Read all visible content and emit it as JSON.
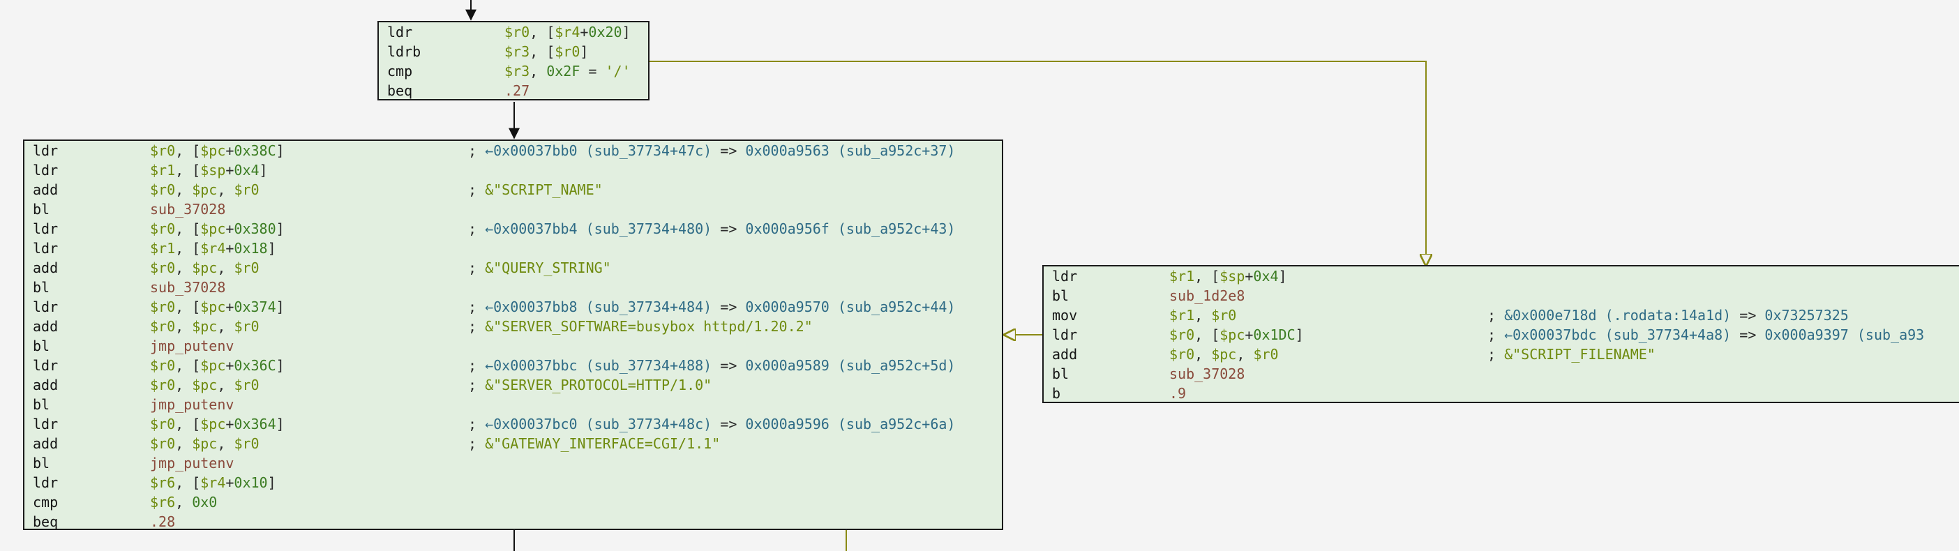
{
  "blocks": {
    "top": [
      [
        "ldr",
        "$r0",
        ", [",
        "$r4",
        "+",
        "0x20",
        "]"
      ],
      [
        "ldrb",
        "$r3",
        ", [",
        "$r0",
        "]"
      ],
      [
        "cmp",
        "$r3",
        ", ",
        "0x2F",
        " = ",
        "'/'"
      ],
      [
        "beq",
        ".27"
      ]
    ],
    "left": [
      {
        "m": "ldr",
        "o": [
          "$r0",
          ", [",
          "$pc",
          "+",
          "0x38C",
          "]"
        ],
        "c": [
          "; ",
          "←0x00037bb0 (sub_37734+47c) => 0x000a9563 (sub_a952c+37)"
        ]
      },
      {
        "m": "ldr",
        "o": [
          "$r1",
          ", [",
          "$sp",
          "+",
          "0x4",
          "]"
        ]
      },
      {
        "m": "add",
        "o": [
          "$r0",
          ", ",
          "$pc",
          ", ",
          "$r0"
        ],
        "c": [
          "; ",
          "&\"SCRIPT_NAME\""
        ]
      },
      {
        "m": "bl",
        "o": [
          "sub_37028"
        ]
      },
      {
        "m": "ldr",
        "o": [
          "$r0",
          ", [",
          "$pc",
          "+",
          "0x380",
          "]"
        ],
        "c": [
          "; ",
          "←0x00037bb4 (sub_37734+480) => 0x000a956f (sub_a952c+43)"
        ]
      },
      {
        "m": "ldr",
        "o": [
          "$r1",
          ", [",
          "$r4",
          "+",
          "0x18",
          "]"
        ]
      },
      {
        "m": "add",
        "o": [
          "$r0",
          ", ",
          "$pc",
          ", ",
          "$r0"
        ],
        "c": [
          "; ",
          "&\"QUERY_STRING\""
        ]
      },
      {
        "m": "bl",
        "o": [
          "sub_37028"
        ]
      },
      {
        "m": "ldr",
        "o": [
          "$r0",
          ", [",
          "$pc",
          "+",
          "0x374",
          "]"
        ],
        "c": [
          "; ",
          "←0x00037bb8 (sub_37734+484) => 0x000a9570 (sub_a952c+44)"
        ]
      },
      {
        "m": "add",
        "o": [
          "$r0",
          ", ",
          "$pc",
          ", ",
          "$r0"
        ],
        "c": [
          "; ",
          "&\"SERVER_SOFTWARE=busybox httpd/1.20.2\""
        ]
      },
      {
        "m": "bl",
        "o": [
          "jmp_putenv"
        ]
      },
      {
        "m": "ldr",
        "o": [
          "$r0",
          ", [",
          "$pc",
          "+",
          "0x36C",
          "]"
        ],
        "c": [
          "; ",
          "←0x00037bbc (sub_37734+488) => 0x000a9589 (sub_a952c+5d)"
        ]
      },
      {
        "m": "add",
        "o": [
          "$r0",
          ", ",
          "$pc",
          ", ",
          "$r0"
        ],
        "c": [
          "; ",
          "&\"SERVER_PROTOCOL=HTTP/1.0\""
        ]
      },
      {
        "m": "bl",
        "o": [
          "jmp_putenv"
        ]
      },
      {
        "m": "ldr",
        "o": [
          "$r0",
          ", [",
          "$pc",
          "+",
          "0x364",
          "]"
        ],
        "c": [
          "; ",
          "←0x00037bc0 (sub_37734+48c) => 0x000a9596 (sub_a952c+6a)"
        ]
      },
      {
        "m": "add",
        "o": [
          "$r0",
          ", ",
          "$pc",
          ", ",
          "$r0"
        ],
        "c": [
          "; ",
          "&\"GATEWAY_INTERFACE=CGI/1.1\""
        ]
      },
      {
        "m": "bl",
        "o": [
          "jmp_putenv"
        ]
      },
      {
        "m": "ldr",
        "o": [
          "$r6",
          ", [",
          "$r4",
          "+",
          "0x10",
          "]"
        ]
      },
      {
        "m": "cmp",
        "o": [
          "$r6",
          ", ",
          "0x0"
        ]
      },
      {
        "m": "beq",
        "o": [
          ".28"
        ]
      }
    ],
    "right": [
      {
        "m": "ldr",
        "o": [
          "$r1",
          ", [",
          "$sp",
          "+",
          "0x4",
          "]"
        ]
      },
      {
        "m": "bl",
        "o": [
          "sub_1d2e8"
        ]
      },
      {
        "m": "mov",
        "o": [
          "$r1",
          ", ",
          "$r0"
        ],
        "c": [
          "; ",
          "&0x000e718d (.rodata:14a1d) => 0x73257325"
        ]
      },
      {
        "m": "ldr",
        "o": [
          "$r0",
          ", [",
          "$pc",
          "+",
          "0x1DC",
          "]"
        ],
        "c": [
          "; ",
          "←0x00037bdc (sub_37734+4a8) => 0x000a9397 (sub_a93"
        ]
      },
      {
        "m": "add",
        "o": [
          "$r0",
          ", ",
          "$pc",
          ", ",
          "$r0"
        ],
        "c": [
          "; ",
          "&\"SCRIPT_FILENAME\""
        ]
      },
      {
        "m": "bl",
        "o": [
          "sub_37028"
        ]
      },
      {
        "m": "b",
        "o": [
          ".9"
        ]
      }
    ]
  },
  "colors": {
    "block_bg": "#e2efe0",
    "edge_true": "#111111",
    "edge_false": "#8a8a14"
  }
}
